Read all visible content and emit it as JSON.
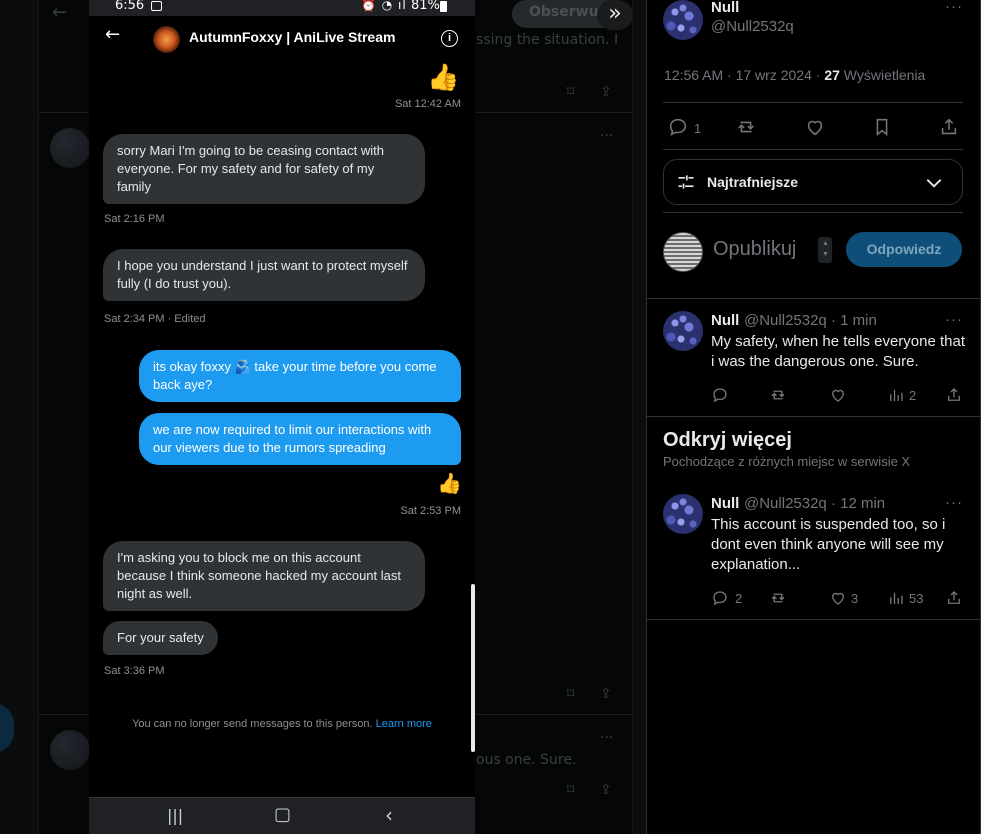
{
  "background": {
    "follow_button": "Obserwuj",
    "snippet_top": "ssing the situation. I",
    "snippet_bottom": "ous one. Sure."
  },
  "phone": {
    "status": {
      "time": "6:56",
      "battery": "81%"
    },
    "header": {
      "name": "AutumnFoxxy | AniLive Stream"
    },
    "messages": {
      "t1": "Sat 12:42 AM",
      "m1": "sorry Mari I'm going to be ceasing contact with everyone. For my safety and for safety of my family",
      "t2": "Sat 2:16 PM",
      "m2": "I hope you understand I just want to protect myself fully (I do trust you).",
      "t3": "Sat 2:34 PM · Edited",
      "m3": "its okay foxxy 🫂 take your time before you come back aye?",
      "m4": "we are now required to limit our interactions with our viewers due to the rumors spreading",
      "t4": "Sat 2:53 PM",
      "m5": "I'm asking you to block me on this account because I think someone hacked my account last night as well.",
      "m6": "For your safety",
      "t5": "Sat 3:36 PM"
    },
    "notice": {
      "text": "You can no longer send messages to this person.",
      "link": "Learn more"
    }
  },
  "panel": {
    "post": {
      "name": "Null",
      "handle": "@Null2532q",
      "time": "12:56 AM · 17 wrz 2024 · ",
      "views_count": "27",
      "views_label": "Wyświetlenia",
      "reply_count": "1"
    },
    "sort": {
      "label": "Najtrafniejsze"
    },
    "reply_box": {
      "placeholder": "Opublikuj",
      "button": "Odpowiedz"
    },
    "reply1": {
      "name": "Null",
      "meta": "@Null2532q · 1 min",
      "text": "My safety, when he tells everyone that i was the dangerous one. Sure.",
      "views": "2"
    },
    "discover": {
      "title": "Odkryj więcej",
      "subtitle": "Pochodzące z różnych miejsc w serwisie X"
    },
    "reply2": {
      "name": "Null",
      "meta": "@Null2532q · 12 min",
      "text": "This account is suspended too, so i dont even think anyone will see my explanation...",
      "replies": "2",
      "likes": "3",
      "views": "53"
    }
  }
}
